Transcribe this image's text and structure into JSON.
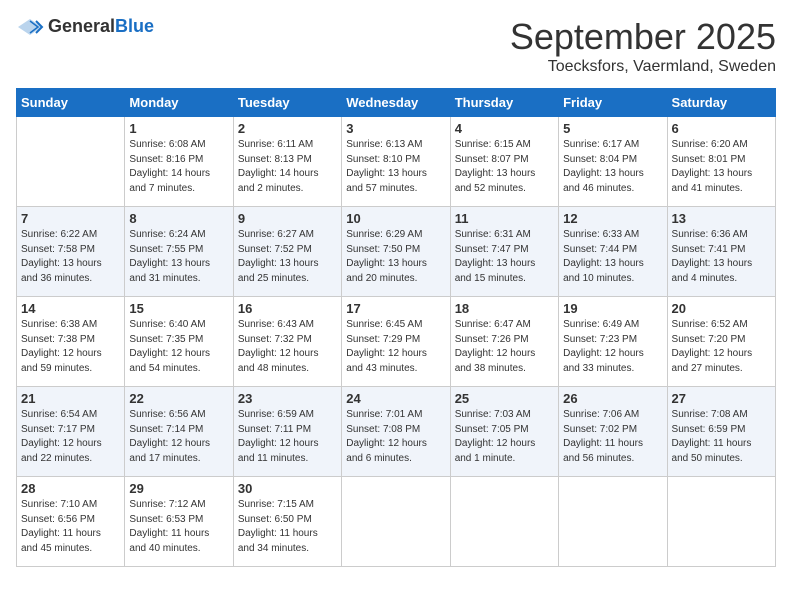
{
  "header": {
    "logo_general": "General",
    "logo_blue": "Blue",
    "month": "September 2025",
    "location": "Toecksfors, Vaermland, Sweden"
  },
  "days_of_week": [
    "Sunday",
    "Monday",
    "Tuesday",
    "Wednesday",
    "Thursday",
    "Friday",
    "Saturday"
  ],
  "weeks": [
    [
      {
        "day": "",
        "info": ""
      },
      {
        "day": "1",
        "info": "Sunrise: 6:08 AM\nSunset: 8:16 PM\nDaylight: 14 hours\nand 7 minutes."
      },
      {
        "day": "2",
        "info": "Sunrise: 6:11 AM\nSunset: 8:13 PM\nDaylight: 14 hours\nand 2 minutes."
      },
      {
        "day": "3",
        "info": "Sunrise: 6:13 AM\nSunset: 8:10 PM\nDaylight: 13 hours\nand 57 minutes."
      },
      {
        "day": "4",
        "info": "Sunrise: 6:15 AM\nSunset: 8:07 PM\nDaylight: 13 hours\nand 52 minutes."
      },
      {
        "day": "5",
        "info": "Sunrise: 6:17 AM\nSunset: 8:04 PM\nDaylight: 13 hours\nand 46 minutes."
      },
      {
        "day": "6",
        "info": "Sunrise: 6:20 AM\nSunset: 8:01 PM\nDaylight: 13 hours\nand 41 minutes."
      }
    ],
    [
      {
        "day": "7",
        "info": "Sunrise: 6:22 AM\nSunset: 7:58 PM\nDaylight: 13 hours\nand 36 minutes."
      },
      {
        "day": "8",
        "info": "Sunrise: 6:24 AM\nSunset: 7:55 PM\nDaylight: 13 hours\nand 31 minutes."
      },
      {
        "day": "9",
        "info": "Sunrise: 6:27 AM\nSunset: 7:52 PM\nDaylight: 13 hours\nand 25 minutes."
      },
      {
        "day": "10",
        "info": "Sunrise: 6:29 AM\nSunset: 7:50 PM\nDaylight: 13 hours\nand 20 minutes."
      },
      {
        "day": "11",
        "info": "Sunrise: 6:31 AM\nSunset: 7:47 PM\nDaylight: 13 hours\nand 15 minutes."
      },
      {
        "day": "12",
        "info": "Sunrise: 6:33 AM\nSunset: 7:44 PM\nDaylight: 13 hours\nand 10 minutes."
      },
      {
        "day": "13",
        "info": "Sunrise: 6:36 AM\nSunset: 7:41 PM\nDaylight: 13 hours\nand 4 minutes."
      }
    ],
    [
      {
        "day": "14",
        "info": "Sunrise: 6:38 AM\nSunset: 7:38 PM\nDaylight: 12 hours\nand 59 minutes."
      },
      {
        "day": "15",
        "info": "Sunrise: 6:40 AM\nSunset: 7:35 PM\nDaylight: 12 hours\nand 54 minutes."
      },
      {
        "day": "16",
        "info": "Sunrise: 6:43 AM\nSunset: 7:32 PM\nDaylight: 12 hours\nand 48 minutes."
      },
      {
        "day": "17",
        "info": "Sunrise: 6:45 AM\nSunset: 7:29 PM\nDaylight: 12 hours\nand 43 minutes."
      },
      {
        "day": "18",
        "info": "Sunrise: 6:47 AM\nSunset: 7:26 PM\nDaylight: 12 hours\nand 38 minutes."
      },
      {
        "day": "19",
        "info": "Sunrise: 6:49 AM\nSunset: 7:23 PM\nDaylight: 12 hours\nand 33 minutes."
      },
      {
        "day": "20",
        "info": "Sunrise: 6:52 AM\nSunset: 7:20 PM\nDaylight: 12 hours\nand 27 minutes."
      }
    ],
    [
      {
        "day": "21",
        "info": "Sunrise: 6:54 AM\nSunset: 7:17 PM\nDaylight: 12 hours\nand 22 minutes."
      },
      {
        "day": "22",
        "info": "Sunrise: 6:56 AM\nSunset: 7:14 PM\nDaylight: 12 hours\nand 17 minutes."
      },
      {
        "day": "23",
        "info": "Sunrise: 6:59 AM\nSunset: 7:11 PM\nDaylight: 12 hours\nand 11 minutes."
      },
      {
        "day": "24",
        "info": "Sunrise: 7:01 AM\nSunset: 7:08 PM\nDaylight: 12 hours\nand 6 minutes."
      },
      {
        "day": "25",
        "info": "Sunrise: 7:03 AM\nSunset: 7:05 PM\nDaylight: 12 hours\nand 1 minute."
      },
      {
        "day": "26",
        "info": "Sunrise: 7:06 AM\nSunset: 7:02 PM\nDaylight: 11 hours\nand 56 minutes."
      },
      {
        "day": "27",
        "info": "Sunrise: 7:08 AM\nSunset: 6:59 PM\nDaylight: 11 hours\nand 50 minutes."
      }
    ],
    [
      {
        "day": "28",
        "info": "Sunrise: 7:10 AM\nSunset: 6:56 PM\nDaylight: 11 hours\nand 45 minutes."
      },
      {
        "day": "29",
        "info": "Sunrise: 7:12 AM\nSunset: 6:53 PM\nDaylight: 11 hours\nand 40 minutes."
      },
      {
        "day": "30",
        "info": "Sunrise: 7:15 AM\nSunset: 6:50 PM\nDaylight: 11 hours\nand 34 minutes."
      },
      {
        "day": "",
        "info": ""
      },
      {
        "day": "",
        "info": ""
      },
      {
        "day": "",
        "info": ""
      },
      {
        "day": "",
        "info": ""
      }
    ]
  ]
}
